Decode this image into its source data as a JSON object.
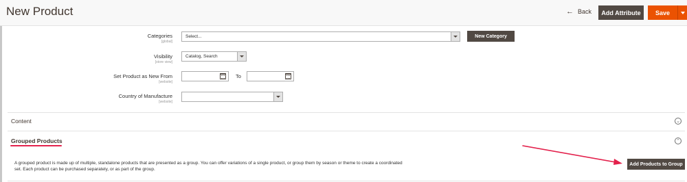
{
  "header": {
    "title": "New Product",
    "back_label": "Back",
    "add_attribute_label": "Add Attribute",
    "save_label": "Save"
  },
  "form": {
    "categories": {
      "label": "Categories",
      "scope": "[global]",
      "value": "Select..."
    },
    "new_category_label": "New Category",
    "visibility": {
      "label": "Visibility",
      "scope": "[store view]",
      "value": "Catalog, Search"
    },
    "new_from": {
      "label": "Set Product as New From",
      "scope": "[website]",
      "from_value": "",
      "to_label": "To",
      "to_value": ""
    },
    "country": {
      "label": "Country of Manufacture",
      "scope": "[website]",
      "value": ""
    }
  },
  "sections": {
    "content_title": "Content",
    "grouped_title": "Grouped Products",
    "grouped_description": "A grouped product is made up of multiple, standalone products that are presented as a group. You can offer variations of a single product, or group them by season or theme to create a coordinated set. Each product can be purchased separately, or as part of the group.",
    "add_products_label": "Add Products to Group"
  },
  "colors": {
    "accent_orange": "#eb5202",
    "dark_button": "#514943",
    "annotation_red": "#e3204b"
  }
}
